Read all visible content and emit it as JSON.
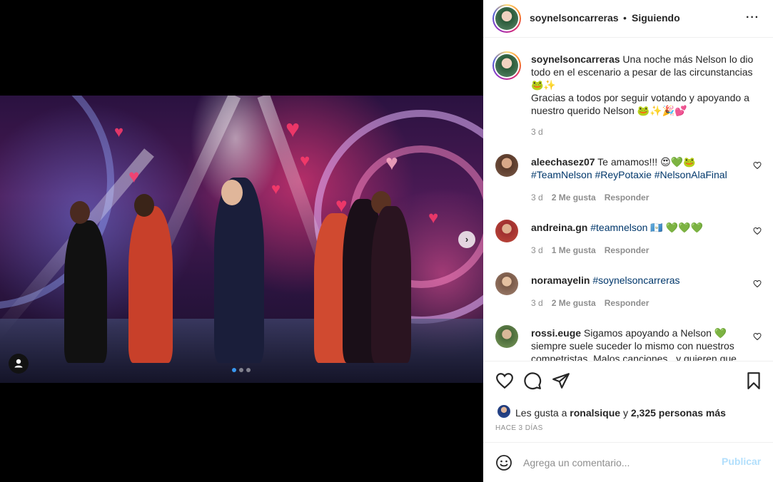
{
  "header": {
    "username": "soynelsoncarreras",
    "separator": "•",
    "follow_status": "Siguiendo",
    "more_icon": "···"
  },
  "caption": {
    "username": "soynelsoncarreras",
    "text_line1": "Una noche más Nelson lo dio todo en el escenario a pesar de las circunstancias 🐸✨",
    "text_line2": "Gracias a todos por seguir votando y apoyando a nuestro querido Nelson 🐸✨🎉💕",
    "time": "3 d"
  },
  "comments": [
    {
      "username": "aleechasez07",
      "text": "Te amamos!!! 😍💚🐸",
      "tags": "#TeamNelson #ReyPotaxie #NelsonAlaFinal",
      "time": "3 d",
      "likes": "2 Me gusta",
      "reply": "Responder",
      "avatar_color": "#6a4a3a"
    },
    {
      "username": "andreina.gn",
      "text": "💚💚💚",
      "tags": "#teamnelson 🇬🇹",
      "time": "3 d",
      "likes": "1 Me gusta",
      "reply": "Responder",
      "avatar_color": "#a03030"
    },
    {
      "username": "noramayelin",
      "text": "",
      "tags": "#soynelsoncarreras",
      "time": "3 d",
      "likes": "2 Me gusta",
      "reply": "Responder",
      "avatar_color": "#7a5a48"
    },
    {
      "username": "rossi.euge",
      "text": "Sigamos apoyando a Nelson 💚 siempre suele suceder lo mismo con nuestros competristas. Malos canciones.. y quieren que",
      "tags": "",
      "time": "",
      "likes": "",
      "reply": "",
      "avatar_color": "#4a6a3a"
    }
  ],
  "likes_line": {
    "prefix": "Les gusta a",
    "user": "ronalsique",
    "connector": "y",
    "others": "2,325 personas más"
  },
  "posted": "HACE 3 DÍAS",
  "add_comment": {
    "placeholder": "Agrega un comentario...",
    "publish": "Publicar"
  },
  "carousel": {
    "slides": 3,
    "active": 1
  },
  "colors": {
    "link": "#00376b",
    "muted": "#8e8e8e",
    "publish_disabled": "#b2dffc",
    "carousel_active": "#3897f0"
  }
}
